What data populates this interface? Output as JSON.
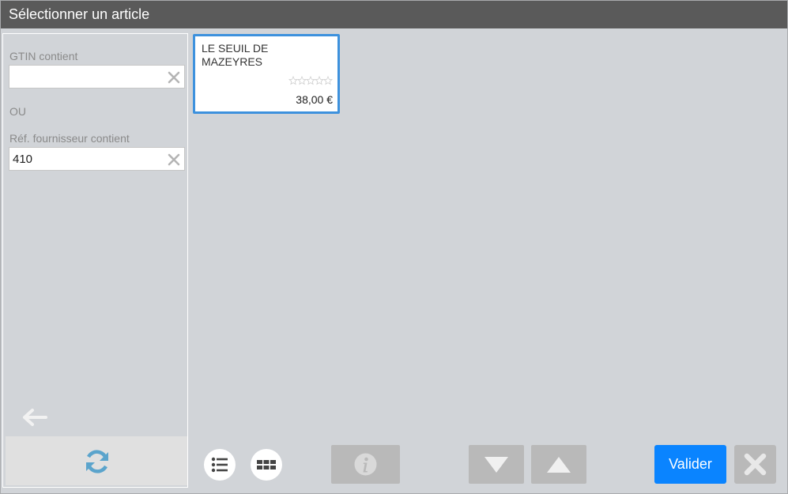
{
  "title": "Sélectionner un article",
  "filters": {
    "gtin_label": "GTIN contient",
    "gtin_value": "",
    "separator": "OU",
    "ref_label": "Réf. fournisseur contient",
    "ref_value": "410"
  },
  "results": [
    {
      "name": "LE SEUIL DE MAZEYRES",
      "price": "38,00 €",
      "rating": 0
    }
  ],
  "footer": {
    "valider_label": "Valider"
  },
  "icons": {
    "back": "arrow-left-icon",
    "refresh": "refresh-icon",
    "list_view": "list-view-icon",
    "grid_view": "grid-view-icon",
    "info": "info-icon",
    "down": "triangle-down-icon",
    "up": "triangle-up-icon",
    "close": "close-icon"
  },
  "colors": {
    "titlebar": "#5a5a5a",
    "background": "#d1d4d8",
    "accent": "#0a84ff",
    "selection_border": "#3d91dd",
    "disabled_button": "#b9b9b9"
  }
}
